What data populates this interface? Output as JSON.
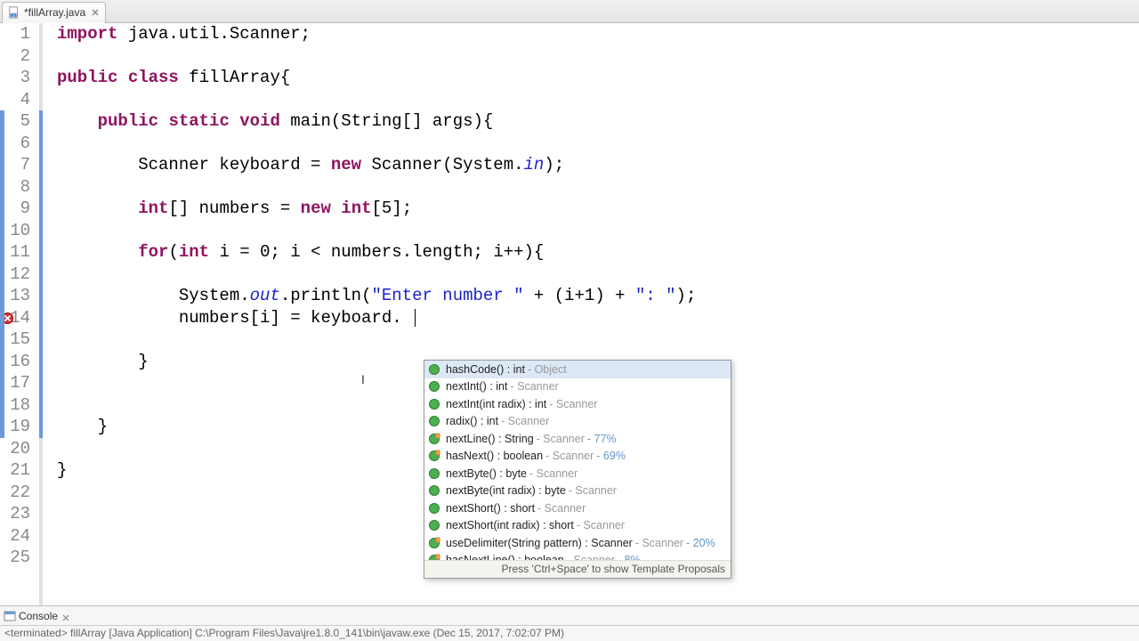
{
  "tab": {
    "filename": "*fillArray.java"
  },
  "code": {
    "lines": [
      {
        "n": 1,
        "html": "<span class='kw'>import</span> java.util.Scanner;"
      },
      {
        "n": 2,
        "html": ""
      },
      {
        "n": 3,
        "html": "<span class='kw'>public</span> <span class='kw'>class</span> fillArray{"
      },
      {
        "n": 4,
        "html": ""
      },
      {
        "n": 5,
        "html": "    <span class='kw'>public</span> <span class='kw'>static</span> <span class='kw'>void</span> main(String[] args){"
      },
      {
        "n": 6,
        "html": ""
      },
      {
        "n": 7,
        "html": "        Scanner keyboard = <span class='kw'>new</span> Scanner(System.<span class='field'>in</span>);"
      },
      {
        "n": 8,
        "html": ""
      },
      {
        "n": 9,
        "html": "        <span class='kw'>int</span>[] numbers = <span class='kw'>new</span> <span class='kw'>int</span>[5];"
      },
      {
        "n": 10,
        "html": ""
      },
      {
        "n": 11,
        "html": "        <span class='kw'>for</span>(<span class='kw'>int</span> i = 0; i &lt; numbers.length; i++){"
      },
      {
        "n": 12,
        "html": ""
      },
      {
        "n": 13,
        "html": "            System.<span class='field'>out</span>.println(<span class='str'>\"Enter number \"</span> + (i+1) + <span class='str'>\": \"</span>);"
      },
      {
        "n": 14,
        "html": "            numbers[i] = keyboard.",
        "error": true
      },
      {
        "n": 15,
        "html": ""
      },
      {
        "n": 16,
        "html": "        }"
      },
      {
        "n": 17,
        "html": ""
      },
      {
        "n": 18,
        "html": ""
      },
      {
        "n": 19,
        "html": "    }"
      },
      {
        "n": 20,
        "html": ""
      },
      {
        "n": 21,
        "html": "}"
      },
      {
        "n": 22,
        "html": ""
      },
      {
        "n": 23,
        "html": ""
      },
      {
        "n": 24,
        "html": ""
      },
      {
        "n": 25,
        "html": ""
      }
    ],
    "blue_strip_range": [
      5,
      19
    ],
    "error_line": 14,
    "cursor_line": 14
  },
  "autocomplete": {
    "items": [
      {
        "sig": "hashCode() : int",
        "meta": "Object",
        "pct": "",
        "selected": true,
        "kind": "method"
      },
      {
        "sig": "nextInt() : int",
        "meta": "Scanner",
        "pct": "",
        "kind": "method"
      },
      {
        "sig": "nextInt(int radix) : int",
        "meta": "Scanner",
        "pct": "",
        "kind": "method"
      },
      {
        "sig": "radix() : int",
        "meta": "Scanner",
        "pct": "",
        "kind": "method"
      },
      {
        "sig": "nextLine() : String",
        "meta": "Scanner",
        "pct": "77%",
        "kind": "stat"
      },
      {
        "sig": "hasNext() : boolean",
        "meta": "Scanner",
        "pct": "69%",
        "kind": "stat"
      },
      {
        "sig": "nextByte() : byte",
        "meta": "Scanner",
        "pct": "",
        "kind": "method"
      },
      {
        "sig": "nextByte(int radix) : byte",
        "meta": "Scanner",
        "pct": "",
        "kind": "method"
      },
      {
        "sig": "nextShort() : short",
        "meta": "Scanner",
        "pct": "",
        "kind": "method"
      },
      {
        "sig": "nextShort(int radix) : short",
        "meta": "Scanner",
        "pct": "",
        "kind": "method"
      },
      {
        "sig": "useDelimiter(String pattern) : Scanner",
        "meta": "Scanner",
        "pct": "20%",
        "kind": "stat"
      },
      {
        "sig": "hasNextLine() : boolean",
        "meta": "Scanner",
        "pct": "8%",
        "kind": "stat"
      }
    ],
    "footer": "Press 'Ctrl+Space' to show Template Proposals"
  },
  "console": {
    "tab_label": "Console",
    "status": "<terminated> fillArray [Java Application] C:\\Program Files\\Java\\jre1.8.0_141\\bin\\javaw.exe (Dec 15, 2017, 7:02:07 PM)"
  }
}
